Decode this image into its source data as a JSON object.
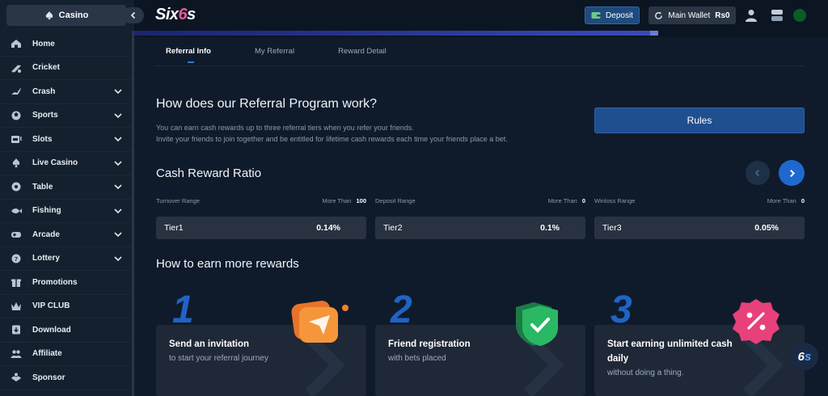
{
  "sidebar": {
    "casino_label": "Casino",
    "items": [
      {
        "label": "Home",
        "icon": "home-icon",
        "has_chevron": false
      },
      {
        "label": "Cricket",
        "icon": "cricket-icon",
        "has_chevron": false
      },
      {
        "label": "Crash",
        "icon": "crash-icon",
        "has_chevron": true
      },
      {
        "label": "Sports",
        "icon": "sports-icon",
        "has_chevron": true
      },
      {
        "label": "Slots",
        "icon": "slots-icon",
        "has_chevron": true
      },
      {
        "label": "Live Casino",
        "icon": "live-casino-icon",
        "has_chevron": true
      },
      {
        "label": "Table",
        "icon": "table-icon",
        "has_chevron": true
      },
      {
        "label": "Fishing",
        "icon": "fishing-icon",
        "has_chevron": true
      },
      {
        "label": "Arcade",
        "icon": "arcade-icon",
        "has_chevron": true
      },
      {
        "label": "Lottery",
        "icon": "lottery-icon",
        "has_chevron": true
      },
      {
        "label": "Promotions",
        "icon": "promotions-icon",
        "has_chevron": false
      },
      {
        "label": "VIP CLUB",
        "icon": "crown-icon",
        "has_chevron": false
      },
      {
        "label": "Download",
        "icon": "download-icon",
        "has_chevron": false
      },
      {
        "label": "Affiliate",
        "icon": "affiliate-icon",
        "has_chevron": false
      },
      {
        "label": "Sponsor",
        "icon": "sponsor-icon",
        "has_chevron": false
      }
    ]
  },
  "header": {
    "logo_prefix": "Six",
    "logo_mid": "6",
    "logo_suffix": "s",
    "deposit_label": "Deposit",
    "wallet_label": "Main Wallet",
    "wallet_balance": "Rs0"
  },
  "tabs": [
    {
      "label": "Referral Info",
      "active": true
    },
    {
      "label": "My Referral",
      "active": false
    },
    {
      "label": "Reward Detail",
      "active": false
    }
  ],
  "program": {
    "title": "How does our Referral Program work?",
    "line1": "You can earn cash rewards up to three referral tiers when you refer your friends.",
    "line2": "Invite your friends to join together and be entitled for lifetime cash rewards each time your friends place a bet.",
    "rules_label": "Rules"
  },
  "ratio": {
    "title": "Cash Reward Ratio",
    "columns": [
      {
        "range_label": "Turnover Range",
        "more_than_label": "More Than",
        "more_than_value": "100",
        "tier": "Tier1",
        "percent": "0.14%"
      },
      {
        "range_label": "Deposit Range",
        "more_than_label": "More Than",
        "more_than_value": "0",
        "tier": "Tier2",
        "percent": "0.1%"
      },
      {
        "range_label": "Winloss Range",
        "more_than_label": "More Than",
        "more_than_value": "0",
        "tier": "Tier3",
        "percent": "0.05%"
      }
    ]
  },
  "earn": {
    "title": "How to earn more rewards",
    "steps": [
      {
        "number": "1",
        "title": "Send an invitation",
        "subtitle": "to start your referral journey"
      },
      {
        "number": "2",
        "title": "Friend registration",
        "subtitle": "with bets placed"
      },
      {
        "number": "3",
        "title": "Start earning unlimited cash daily",
        "subtitle": "without doing a thing."
      }
    ]
  },
  "floating_logo": {
    "a": "6",
    "b": "s"
  },
  "colors": {
    "accent": "#1f68d0",
    "background": "#0f1b2b",
    "sidebar": "#15202e",
    "logo_pink": "#e45c9a"
  }
}
